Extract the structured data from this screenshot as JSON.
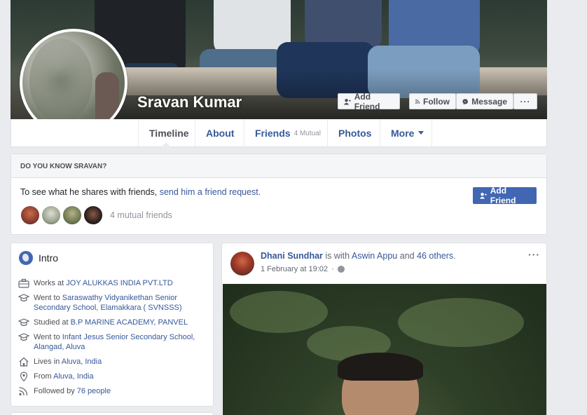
{
  "profile": {
    "name": "Sravan Kumar"
  },
  "cover_actions": {
    "add_friend": "Add Friend",
    "follow": "Follow",
    "message": "Message",
    "more": "···"
  },
  "nav": {
    "timeline": "Timeline",
    "about": "About",
    "friends": "Friends",
    "friends_count": "4 Mutual",
    "photos": "Photos",
    "more": "More"
  },
  "know_card": {
    "header": "DO YOU KNOW SRAVAN?",
    "text_prefix": "To see what he shares with friends, ",
    "text_link": "send him a friend request.",
    "button": "Add Friend",
    "mutual_label": "4 mutual friends",
    "mutual_avatar_colors": [
      "#8a3a2e",
      "#7a8a70",
      "#6d7a52",
      "#2a1f1f"
    ]
  },
  "intro": {
    "title": "Intro",
    "rows": [
      {
        "icon": "briefcase-icon",
        "prefix": "Works at ",
        "link": "JOY ALUKKAS INDIA PVT.LTD",
        "suffix": ""
      },
      {
        "icon": "graduation-cap-icon",
        "prefix": "Went to ",
        "link": "Saraswathy Vidyanikethan Senior Secondary School, Elamakkara ( SVNSSS)",
        "suffix": ""
      },
      {
        "icon": "graduation-cap-icon",
        "prefix": "Studied at ",
        "link": "B.P MARINE ACADEMY, PANVEL",
        "suffix": ""
      },
      {
        "icon": "graduation-cap-icon",
        "prefix": "Went to ",
        "link": "Infant Jesus Senior Secondary School, Alangad, Aluva",
        "suffix": ""
      },
      {
        "icon": "home-icon",
        "prefix": "Lives in ",
        "link": "Aluva, India",
        "suffix": ""
      },
      {
        "icon": "location-pin-icon",
        "prefix": "From ",
        "link": "Aluva, India",
        "suffix": ""
      },
      {
        "icon": "rss-icon",
        "prefix": "Followed by ",
        "link": "76 people",
        "suffix": ""
      }
    ]
  },
  "post": {
    "author": "Dhani Sundhar",
    "with_text": " is with ",
    "with_person": "Aswin Appu",
    "and_text": " and ",
    "others": "46 others",
    "period": ".",
    "date": "1 February at 19:02",
    "dot": "·",
    "more": "···"
  },
  "colors": {
    "brand": "#4267b2",
    "link": "#365899",
    "background": "#e9ebee"
  }
}
